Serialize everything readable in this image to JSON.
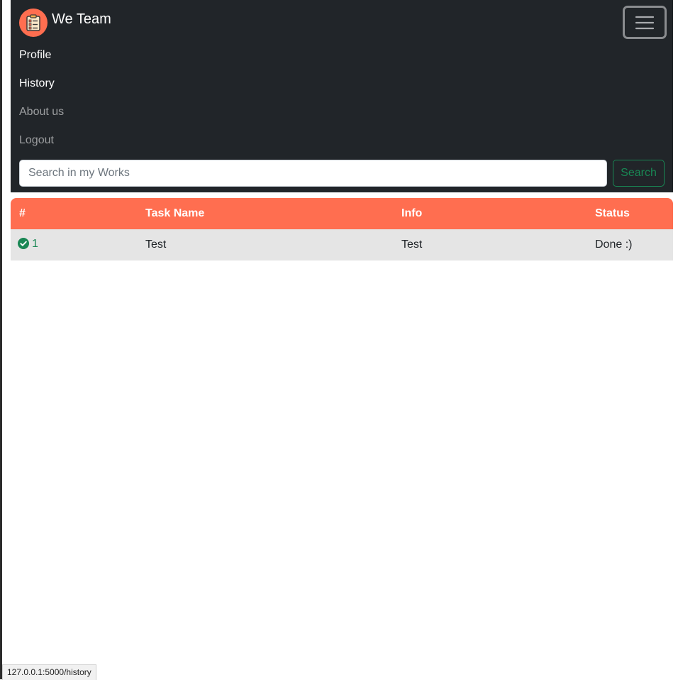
{
  "brand": {
    "name": "We Team",
    "logo_icon": "clipboard-list-icon",
    "logo_color": "#ff6e50"
  },
  "navbar": {
    "background": "#212529",
    "toggler_icon": "hamburger-menu-icon",
    "items": [
      {
        "label": "Profile",
        "state": "active"
      },
      {
        "label": "History",
        "state": "active"
      },
      {
        "label": "About us",
        "state": "muted"
      },
      {
        "label": "Logout",
        "state": "muted"
      }
    ]
  },
  "search": {
    "placeholder": "Search in my Works",
    "value": "",
    "button_label": "Search",
    "button_color": "#198754"
  },
  "table": {
    "header_color": "#ff6e50",
    "columns": [
      "#",
      "Task Name",
      "Info",
      "Status"
    ],
    "rows": [
      {
        "number": "1",
        "icon": "check-circle-icon",
        "task_name": "Test",
        "info": "Test",
        "status": "Done :)"
      }
    ]
  },
  "statusbar": {
    "url": "127.0.0.1:5000/history"
  }
}
